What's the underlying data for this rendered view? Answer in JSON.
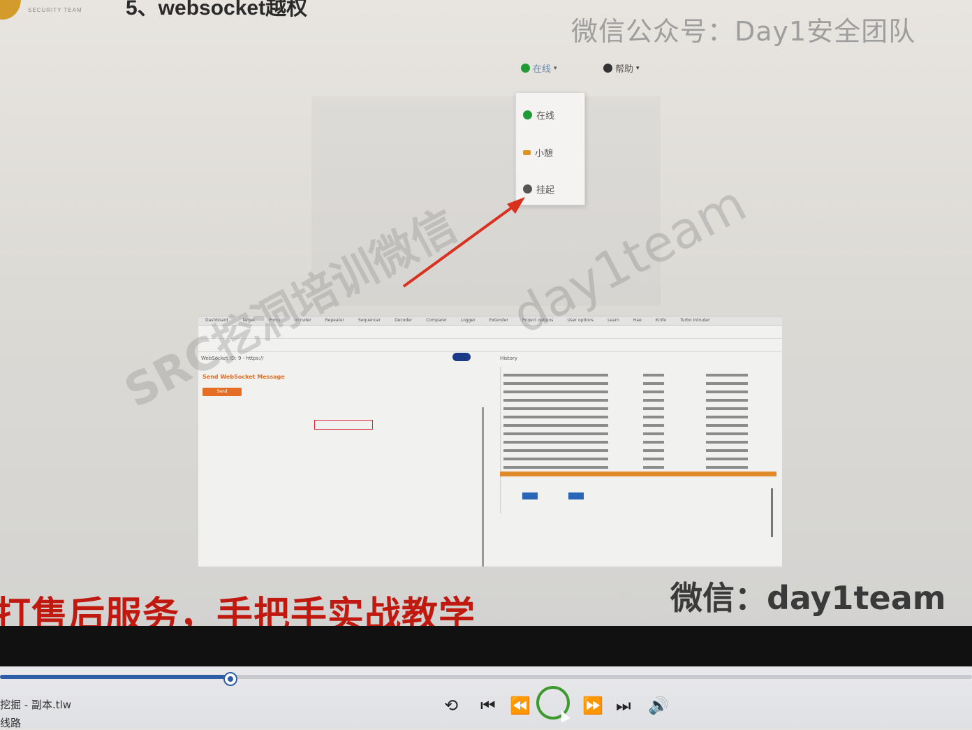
{
  "slide": {
    "logo_text": "SECURITY TEAM",
    "title": "5、websocket越权",
    "watermark_top": "微信公众号：Day1安全团队",
    "watermark_bottom": "微信：day1team",
    "diagonal_watermark": "SRC挖洞培训微信",
    "diagonal_watermark_2": "day1team",
    "subtitle": "打售后服务，手把手实战教学"
  },
  "status_menu": {
    "current_label": "在线",
    "help_label": "帮助",
    "options": [
      {
        "label": "在线",
        "color": "#1f9a35"
      },
      {
        "label": "小憩",
        "color": "#e0921f"
      },
      {
        "label": "挂起",
        "color": "#555555"
      }
    ]
  },
  "burp": {
    "tabs": [
      "Dashboard",
      "Target",
      "Proxy",
      "Intruder",
      "Repeater",
      "Sequencer",
      "Decoder",
      "Comparer",
      "Logger",
      "Extender",
      "Project options",
      "User options",
      "Learn",
      "Hae",
      "Knife",
      "Turbo Intruder"
    ],
    "websocket_label": "WebSocket ID: 9 - https://",
    "history_label": "History",
    "send_heading": "Send WebSocket Message",
    "send_button": "Send"
  },
  "player": {
    "filename": "挖掘 - 副本.tlw",
    "route_label": "线路",
    "progress": 0.237,
    "controls": [
      "loop-icon",
      "prev-icon",
      "rewind-icon",
      "play-icon",
      "forward-icon",
      "next-icon",
      "volume-icon"
    ]
  },
  "colors": {
    "subtitle": "#c01a10",
    "progress": "#2f5ea8",
    "play_ring": "#3e9a2e",
    "burp_accent": "#e56d25"
  }
}
